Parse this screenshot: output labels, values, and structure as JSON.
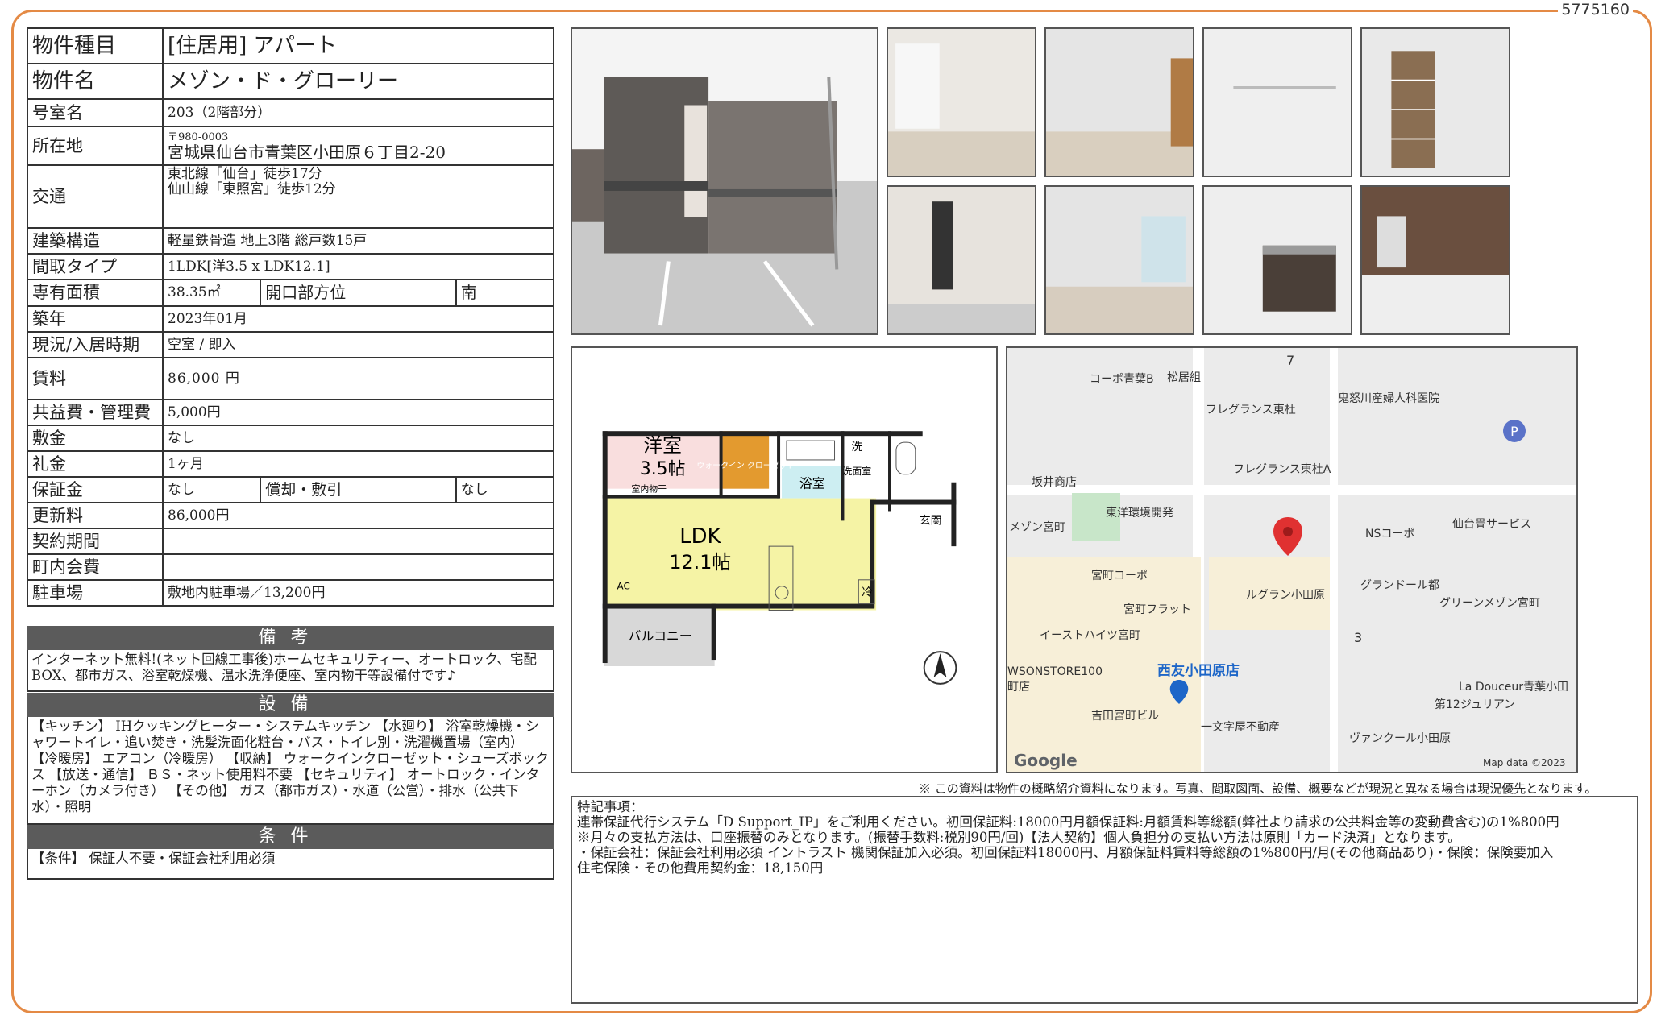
{
  "doc_id": "5775160",
  "property": {
    "type_label": "物件種目",
    "type_value": "[住居用]  アパート",
    "name_label": "物件名",
    "name_value": "メゾン・ド・グローリー",
    "room_label": "号室名",
    "room_value": "203（2階部分）",
    "address_label": "所在地",
    "postal": "〒980-0003",
    "address": "宮城県仙台市青葉区小田原６丁目2-20",
    "transport_label": "交通",
    "transport_1": "東北線「仙台」徒歩17分",
    "transport_2": "仙山線「東照宮」徒歩12分",
    "structure_label": "建築構造",
    "structure_value": "軽量鉄骨造 地上3階 総戸数15戸",
    "layout_label": "間取タイプ",
    "layout_value": "1LDK[洋3.5 x LDK12.1]",
    "area_label": "専有面積",
    "area_value": "38.35㎡",
    "opening_label": "開口部方位",
    "opening_value": "南",
    "built_label": "築年",
    "built_value": "2023年01月",
    "status_label": "現況/入居時期",
    "status_value": "空室 /  即入",
    "rent_label": "賃料",
    "rent_value": "86,000 円",
    "fee_label": "共益費・管理費",
    "fee_value": "5,000円",
    "deposit_label": "敷金",
    "deposit_value": "なし",
    "key_money_label": "礼金",
    "key_money_value": "1ヶ月",
    "guarantee_label": "保証金",
    "guarantee_value": "なし",
    "amort_label": "償却・敷引",
    "amort_value": "なし",
    "renewal_label": "更新料",
    "renewal_value": "86,000円",
    "contract_label": "契約期間",
    "contract_value": "",
    "neighborhood_label": "町内会費",
    "neighborhood_value": "",
    "parking_label": "駐車場",
    "parking_value": "敷地内駐車場／13,200円"
  },
  "remarks": {
    "title": "備考",
    "text": "インターネット無料!(ネット回線工事後)ホームセキュリティー、オートロック、宅配BOX、都市ガス、浴室乾燥機、温水洗浄便座、室内物干等設備付です♪"
  },
  "equipment": {
    "title": "設備",
    "text": "【キッチン】 IHクッキングヒーター・システムキッチン 【水廻り】 浴室乾燥機・シャワートイレ・追い焚き・洗髪洗面化粧台・バス・トイレ別・洗濯機置場（室内） 【冷暖房】 エアコン（冷暖房） 【収納】 ウォークインクローゼット・シューズボックス 【放送・通信】 ＢＳ・ネット使用料不要 【セキュリティ】 オートロック・インターホン（カメラ付き） 【その他】 ガス（都市ガス）・水道（公営）・排水（公共下水）・照明"
  },
  "conditions": {
    "title": "条件",
    "text": "【条件】 保証人不要・保証会社利用必須"
  },
  "floorplan": {
    "room1": "洋室",
    "room1_size": "3.5帖",
    "dry": "室内物干",
    "walkin": "ウォークイン クローゼット",
    "bath": "浴室",
    "wash": "洗面室",
    "wash2": "洗",
    "ldk": "LDK",
    "ldk_size": "12.1帖",
    "ac": "AC",
    "fridge": "冷",
    "entrance": "玄関",
    "balcony": "バルコニー"
  },
  "map": {
    "labels": [
      "コーポ青葉B",
      "松居組",
      "7",
      "フレグランス東杜",
      "鬼怒川産婦人科医院",
      "フレグランス東杜A",
      "坂井商店",
      "東洋環境開発",
      "メゾン宮町",
      "NSコーポ",
      "仙台畳サービス",
      "宮町コーポ",
      "グランドール都",
      "ルグラン小田原",
      "宮町フラット",
      "グリーンメゾン宮町",
      "イーストハイツ宮町",
      "3",
      "西友小田原店",
      "WSONSTORE100",
      "町店",
      "La Douceur青葉小田",
      "第12ジュリアン",
      "吉田宮町ビル",
      "一文字屋不動産",
      "ヴァンクール小田原",
      "Google",
      "Map data ©2023"
    ]
  },
  "notice": "※ この資料は物件の概略紹介資料になります。写真、間取図面、設備、概要などが現況と異なる場合は現況優先となります。",
  "special": {
    "title": "特記事項：",
    "lines": [
      "連帯保証代行システム「D Support_IP」をご利用ください。初回保証料:18000円月額保証料:月額賃料等総額(弊社より請求の公共料金等の変動費含む)の1%800円",
      "  ※月々の支払方法は、口座振替のみとなります。(振替手数料:税別90円/回)【法人契約】個人負担分の支払い方法は原則「カード決済」となります。",
      "・保証会社：保証会社利用必須 イントラスト 機関保証加入必須。初回保証料18000円、月額保証料賃料等総額の1%800円/月(その他商品あり)・保険：保険要加入",
      "  住宅保険・その他費用契約金：18,150円"
    ]
  },
  "colors": {
    "frame": "#e48a45",
    "header_bg": "#5b5b5b",
    "ldk": "#f5f3a5",
    "youshitsu": "#f9dede",
    "walkin": "#e39a2f",
    "bath": "#cdeef2",
    "pin": "#e03131"
  }
}
